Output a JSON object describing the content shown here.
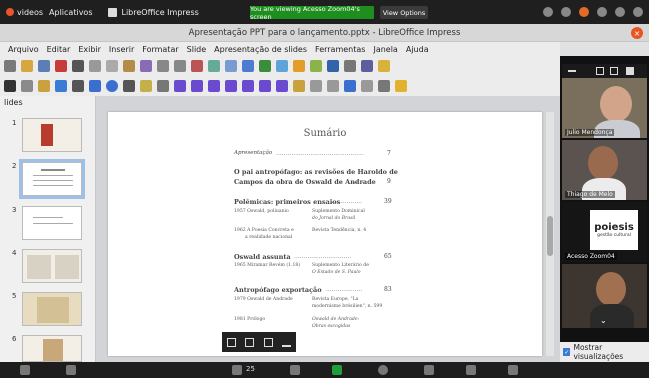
{
  "desktop_bar": {
    "app_menu": "videos",
    "applications": "Aplicativos",
    "active_app": "LibreOffice Impress",
    "zoom_banner": "You are viewing Acesso Zoom04's screen",
    "view_options": "View Options"
  },
  "window": {
    "title": "Apresentação PPT para o lançamento.pptx - LibreOffice Impress",
    "close_symbol": "×"
  },
  "menu": [
    "Arquivo",
    "Editar",
    "Exibir",
    "Inserir",
    "Formatar",
    "Slide",
    "Apresentação de slides",
    "Ferramentas",
    "Janela",
    "Ajuda"
  ],
  "slides_pane": {
    "label": "lides",
    "thumbnails": [
      "1",
      "2",
      "3",
      "4",
      "5",
      "6"
    ],
    "selected": 2
  },
  "slide": {
    "title": "Sumário",
    "entries": [
      {
        "text": "Apresentação",
        "page": "7"
      },
      {
        "text": "O pai antropófago: as revisões de Haroldo de",
        "page": ""
      },
      {
        "text": "Campos da obra de Oswald de Andrade",
        "page": "9"
      },
      {
        "text": "Polêmicas: primeiros ensaios",
        "page": "39"
      },
      {
        "text": "1957   Oswald, poliuanio",
        "page": ""
      },
      {
        "text": "Suplemento Dominical",
        "page": ""
      },
      {
        "text": "do Jornal do Brasil",
        "page": ""
      },
      {
        "text": "1962   A Poesia Concreta e",
        "page": ""
      },
      {
        "text": "a realidade nacional",
        "page": ""
      },
      {
        "text": "Revista Tendência, n. 4",
        "page": ""
      },
      {
        "text": "Oswald assunta",
        "page": "65"
      },
      {
        "text": "1965   Miramar Revém (1.18)",
        "page": ""
      },
      {
        "text": "Suplemento Literário de",
        "page": ""
      },
      {
        "text": "O Estado de S. Paulo",
        "page": ""
      },
      {
        "text": "Antropófago exportação",
        "page": "83"
      },
      {
        "text": "1979   Oswald de Andrade",
        "page": ""
      },
      {
        "text": "Revista Europe, \"La",
        "page": ""
      },
      {
        "text": "modernisme brésilien\", n. 599",
        "page": ""
      },
      {
        "text": "1981   Prólogo",
        "page": ""
      },
      {
        "text": "Oswald de Andrade:",
        "page": ""
      },
      {
        "text": "Obras escogidas",
        "page": ""
      }
    ]
  },
  "participants": [
    {
      "name": "Julio Mendonça"
    },
    {
      "name": "Thiago de Melo"
    },
    {
      "name": "Acesso Zoom04"
    }
  ],
  "poiesis": {
    "logo": "poiesis",
    "sub": "gestão cultural"
  },
  "sidebar_option": {
    "label": "Mostrar visualizações"
  },
  "zoom_bottom": {
    "participants_count": "25"
  },
  "colors": {
    "zoom_green": "#1e8f1e",
    "ubuntu_orange": "#e95420",
    "selection_blue": "#9cc0e8"
  }
}
